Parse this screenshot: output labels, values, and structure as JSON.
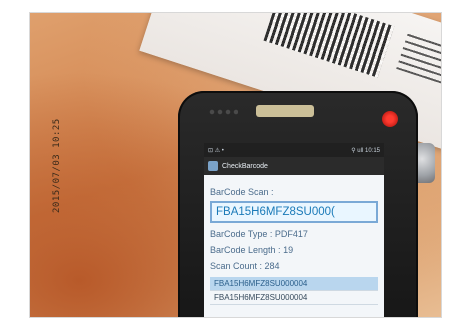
{
  "photo": {
    "timestamp": "2015/07/03 10:25"
  },
  "phone": {
    "status": {
      "left_icons": "⊡ ⚠ •",
      "right_text": "⚲ ull 10:15"
    },
    "app": {
      "title": "CheckBarcode"
    },
    "scan": {
      "label": "BarCode Scan :",
      "value": "FBA15H6MFZ8SU000("
    },
    "barcode_type": {
      "label": "BarCode Type :",
      "value": "PDF417"
    },
    "barcode_length": {
      "label": "BarCode Length :",
      "value": "19"
    },
    "scan_count": {
      "label": "Scan Count :",
      "value": "284"
    },
    "list": [
      "FBA15H6MFZ8SU000004",
      "FBA15H6MFZ8SU000004"
    ]
  }
}
